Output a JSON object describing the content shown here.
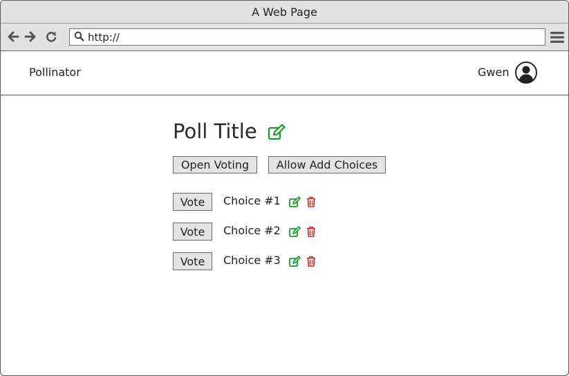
{
  "window": {
    "title": "A Web Page"
  },
  "browser": {
    "url": "http://"
  },
  "app": {
    "brand": "Pollinator",
    "user": "Gwen"
  },
  "poll": {
    "title": "Poll Title"
  },
  "actions": {
    "open_voting": "Open Voting",
    "allow_add_choices": "Allow Add Choices"
  },
  "choices": [
    {
      "vote_label": "Vote",
      "label": "Choice #1"
    },
    {
      "vote_label": "Vote",
      "label": "Choice #2"
    },
    {
      "vote_label": "Vote",
      "label": "Choice #3"
    }
  ],
  "colors": {
    "edit": "#1a9a2a",
    "delete": "#cc2222"
  },
  "icons": [
    "back-arrow-icon",
    "forward-arrow-icon",
    "reload-icon",
    "search-icon",
    "hamburger-menu-icon",
    "user-avatar-icon",
    "edit-icon",
    "trash-icon"
  ]
}
